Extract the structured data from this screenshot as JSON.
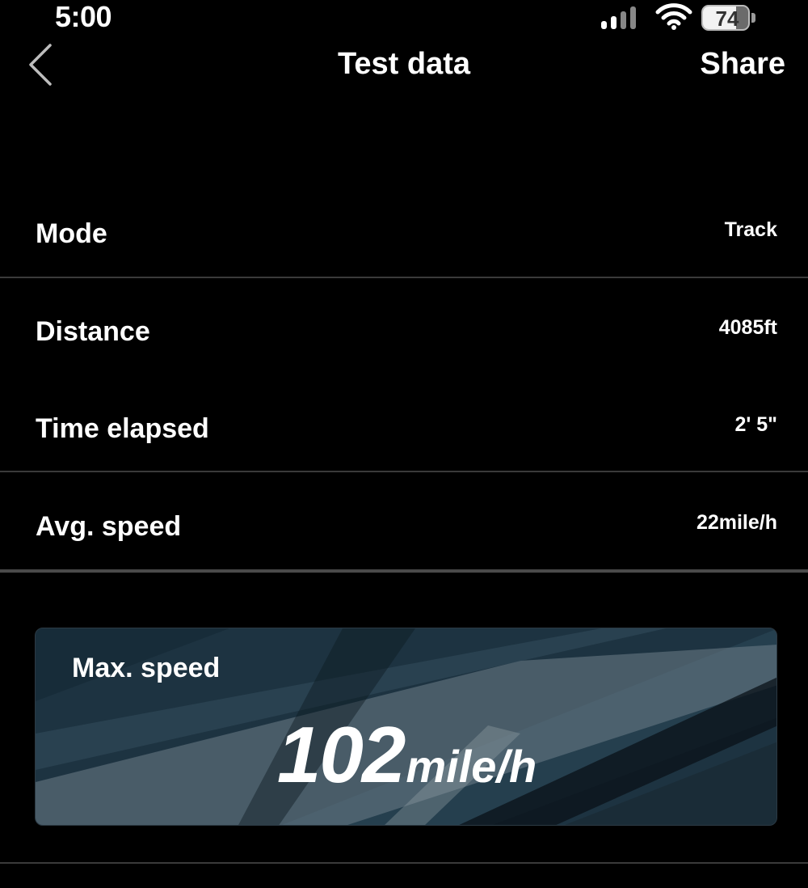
{
  "status_bar": {
    "time": "5:00",
    "battery_level": 74,
    "battery_text": "74",
    "icons": [
      "cellular-signal-icon",
      "wifi-icon",
      "battery-icon"
    ]
  },
  "nav": {
    "back_icon": "chevron-left-icon",
    "title": "Test data",
    "share_label": "Share"
  },
  "rows": [
    {
      "label": "Mode",
      "value": "Track"
    },
    {
      "label": "Distance",
      "value": "4085ft"
    },
    {
      "label": "Time elapsed",
      "value": "2' 5\""
    },
    {
      "label": "Avg. speed",
      "value": "22mile/h"
    }
  ],
  "max_speed": {
    "label": "Max. speed",
    "value": "102",
    "unit": "mile/h"
  },
  "colors": {
    "background": "#000000",
    "text": "#ffffff",
    "divider": "#3a3a3a",
    "card_base": "#1e3442"
  }
}
